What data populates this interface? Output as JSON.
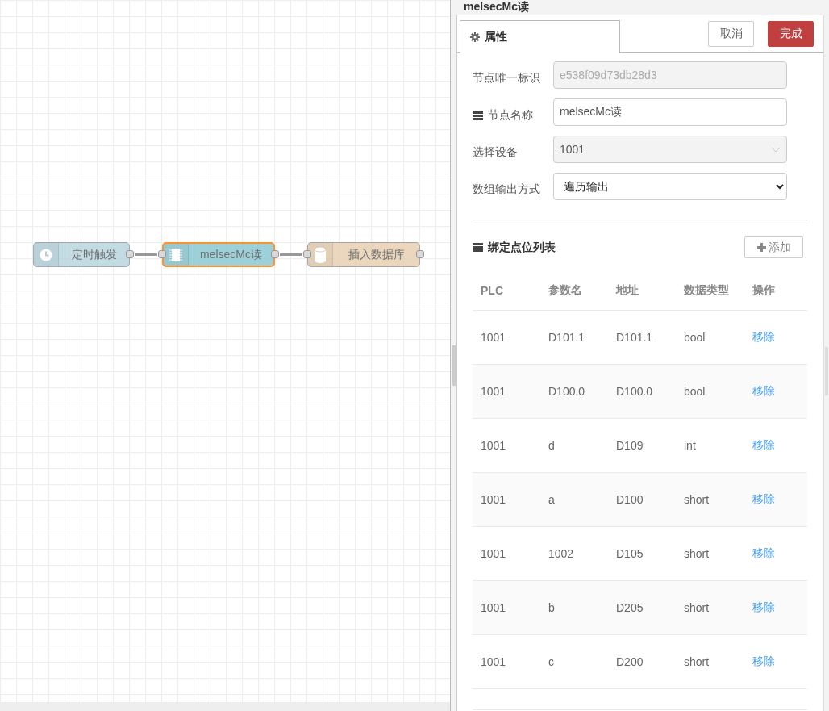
{
  "canvas": {
    "nodes": [
      {
        "label": "定时触发",
        "kind": "clock",
        "color": "#b9d5df",
        "selected": false,
        "input": false,
        "output": true
      },
      {
        "label": "melsecMc读",
        "kind": "chip",
        "color": "#8ccad3",
        "selected": true,
        "input": true,
        "output": true
      },
      {
        "label": "插入数据库",
        "kind": "database",
        "color": "#e7d1b3",
        "selected": false,
        "input": true,
        "output": true
      }
    ]
  },
  "panel": {
    "title": "melsecMc读",
    "tabs": [
      {
        "label": "属性",
        "selected": true
      }
    ],
    "buttons": [
      {
        "label": "取消",
        "kind": "secondary"
      },
      {
        "label": "完成",
        "kind": "primary"
      }
    ],
    "fields": [
      {
        "label": "节点唯一标识",
        "label_icon": false,
        "kind": "text",
        "value": "e538f09d73db28d3",
        "disabled": true
      },
      {
        "label": "节点名称",
        "label_icon": true,
        "kind": "text",
        "value": "melsecMc读",
        "disabled": false
      },
      {
        "label": "选择设备",
        "label_icon": false,
        "kind": "combo",
        "value": "1001",
        "disabled": true
      },
      {
        "label": "数组输出方式",
        "label_icon": false,
        "kind": "select",
        "value": "遍历输出",
        "disabled": false
      }
    ],
    "section": {
      "title": "绑定点位列表",
      "add_button": "添加"
    },
    "table": {
      "columns": [
        "PLC",
        "参数名",
        "地址",
        "数据类型",
        "操作"
      ],
      "rows": [
        {
          "cells": [
            "1001",
            "D101.1",
            "D101.1",
            "bool"
          ],
          "action": "移除"
        },
        {
          "cells": [
            "1001",
            "D100.0",
            "D100.0",
            "bool"
          ],
          "action": "移除"
        },
        {
          "cells": [
            "1001",
            "d",
            "D109",
            "int"
          ],
          "action": "移除"
        },
        {
          "cells": [
            "1001",
            "a",
            "D100",
            "short"
          ],
          "action": "移除"
        },
        {
          "cells": [
            "1001",
            "1002",
            "D105",
            "short"
          ],
          "action": "移除"
        },
        {
          "cells": [
            "1001",
            "b",
            "D205",
            "short"
          ],
          "action": "移除"
        },
        {
          "cells": [
            "1001",
            "c",
            "D200",
            "short"
          ],
          "action": "移除"
        }
      ]
    }
  }
}
